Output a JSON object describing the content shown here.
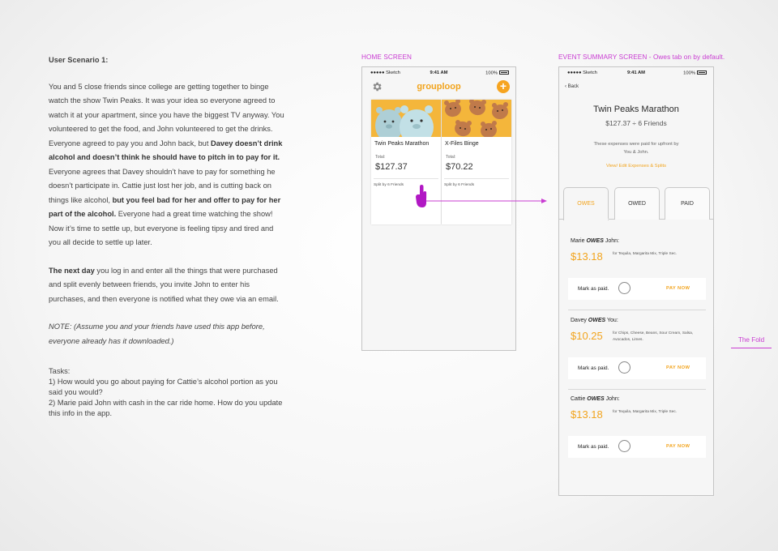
{
  "scenario": {
    "heading": "User Scenario 1:",
    "p1": [
      {
        "t": "You and 5 close friends since college are getting together to binge watch the show Twin Peaks. It was your idea so everyone agreed to watch it at your apartment, since you have the biggest TV anyway. You volunteered to get the food, and John volunteered to get the drinks. Everyone agreed to pay you and John back, but ",
        "b": false
      },
      {
        "t": "Davey doesn’t drink alcohol and doesn’t think he should have to pitch in to pay for it.",
        "b": true
      },
      {
        "t": " Everyone agrees that Davey shouldn’t have to pay for something he doesn’t participate in. Cattie just lost her job, and is cutting back on things like alcohol, ",
        "b": false
      },
      {
        "t": "but you feel bad for her and offer to pay for her part of the alcohol.",
        "b": true
      },
      {
        "t": " Everyone had a great time watching the show! Now it’s time to settle up, but everyone is feeling tipsy and tired and you all decide to settle up later.",
        "b": false
      }
    ],
    "p2_bold": "The next day",
    "p2_rest": " you log in and enter all the things that were purchased and split evenly between friends, you invite John to enter his purchases, and then everyone is notified what they owe via an email.",
    "note": "NOTE: (Assume you and your friends have used this app before, everyone already has it downloaded.)",
    "tasks_heading": "Tasks:",
    "task1": "1) How would you go about paying for Cattie’s alcohol portion as you said you would?",
    "task2": "2) Marie paid John with cash in the car ride home. How do you update this info in the app."
  },
  "labels": {
    "home": "HOME SCREEN",
    "event": "EVENT SUMMARY SCREEN - Owes tab on by default.",
    "fold": "The Fold"
  },
  "status": {
    "carrier": "●●●●● Sketch",
    "time": "9:41 AM",
    "battery": "100%"
  },
  "home": {
    "app_title": "grouploop",
    "plus": "+",
    "cards": [
      {
        "name": "Twin Peaks Marathon",
        "total_label": "Total:",
        "amount": "$127.37",
        "split": "Split by 6 Friends"
      },
      {
        "name": "X-Files Binge",
        "total_label": "Total:",
        "amount": "$70.22",
        "split": "Split by 6 Friends"
      }
    ]
  },
  "event": {
    "back": "Back",
    "title": "Twin Peaks Marathon",
    "subtitle": "$127.37 ÷ 6 Friends",
    "paid_line1": "These expenses were paid for upfront by",
    "paid_line2": "You & John.",
    "link": "View/ Edit Expenses & Splits",
    "tabs": [
      "OWES",
      "OWED",
      "PAID"
    ],
    "owes": [
      {
        "from": "Marie",
        "verb": "OWES",
        "to": "John:",
        "amount": "$13.18",
        "items": "for Tequila, Margarita Mix, Triple Sec.",
        "mark": "Mark as paid.",
        "pay": "PAY NOW"
      },
      {
        "from": "Davey",
        "verb": "OWES",
        "to": "You:",
        "amount": "$10.25",
        "items": "for Chips, Cheese, Beans, Sour Cream, Salsa, Avocados, Limes.",
        "mark": "Mark as paid.",
        "pay": "PAY NOW"
      },
      {
        "from": "Cattie",
        "verb": "OWES",
        "to": "John:",
        "amount": "$13.18",
        "items": "for Tequila, Margarita Mix, Triple Sec.",
        "mark": "Mark as paid.",
        "pay": "PAY NOW"
      }
    ]
  },
  "colors": {
    "accent": "#f2a41d",
    "annotation": "#c93cd2"
  },
  "icons": {
    "settings": "gear-icon",
    "add": "plus-icon",
    "back": "chevron-left-icon",
    "tap": "hand-pointer-icon"
  }
}
